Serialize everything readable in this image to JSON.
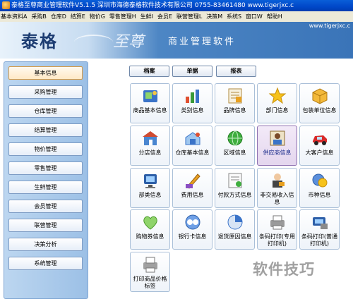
{
  "window": {
    "title": "泰格至尊商业管理软件V5.1.5    深圳市海德泰格软件技术有限公司    0755-83461480    www.tigerjxc.c"
  },
  "menu": [
    "基本资料A",
    "采购B",
    "仓库D",
    "结算E",
    "物价G",
    "零售管理H",
    "生鲜I",
    "会员E",
    "联营管理L",
    "决策M",
    "系统S",
    "窗口W",
    "帮助H"
  ],
  "banner": {
    "brand": "泰格",
    "sub": "至尊",
    "desc": "商业管理软件",
    "site": "www.tigerjxc.c"
  },
  "sidebar": [
    "基本信息",
    "采购管理",
    "仓库管理",
    "结算管理",
    "物价管理",
    "零售管理",
    "生鲜管理",
    "会员管理",
    "联营管理",
    "决策分析",
    "系统管理"
  ],
  "tabs": [
    "档案",
    "单据",
    "报表"
  ],
  "tiles": [
    {
      "label": "商品基本信息",
      "icon": "product-icon"
    },
    {
      "label": "类别信息",
      "icon": "category-icon"
    },
    {
      "label": "品牌信息",
      "icon": "brand-icon"
    },
    {
      "label": "部门信息",
      "icon": "department-star-icon"
    },
    {
      "label": "包装单位信息",
      "icon": "package-unit-icon"
    },
    {
      "label": "分店信息",
      "icon": "branch-store-icon"
    },
    {
      "label": "仓库基本信息",
      "icon": "warehouse-icon"
    },
    {
      "label": "区域信息",
      "icon": "region-globe-icon"
    },
    {
      "label": "供应商信息",
      "icon": "supplier-icon"
    },
    {
      "label": "大客户信息",
      "icon": "key-customer-car-icon"
    },
    {
      "label": "部类信息",
      "icon": "division-icon"
    },
    {
      "label": "费用信息",
      "icon": "expense-icon"
    },
    {
      "label": "付款方式信息",
      "icon": "payment-method-icon"
    },
    {
      "label": "非交易收入信息",
      "icon": "non-trade-income-icon"
    },
    {
      "label": "币种信息",
      "icon": "currency-icon"
    },
    {
      "label": "购物券信息",
      "icon": "voucher-heart-icon"
    },
    {
      "label": "银行卡信息",
      "icon": "bank-card-icon"
    },
    {
      "label": "退货原因信息",
      "icon": "return-reason-icon"
    },
    {
      "label": "条码打印(专用打印机)",
      "icon": "barcode-printer-icon"
    },
    {
      "label": "条码打印(普通打印机)",
      "icon": "barcode-printer-normal-icon"
    },
    {
      "label": "打印商品价格标签",
      "icon": "price-label-printer-icon"
    }
  ],
  "watermark": "软件技巧"
}
